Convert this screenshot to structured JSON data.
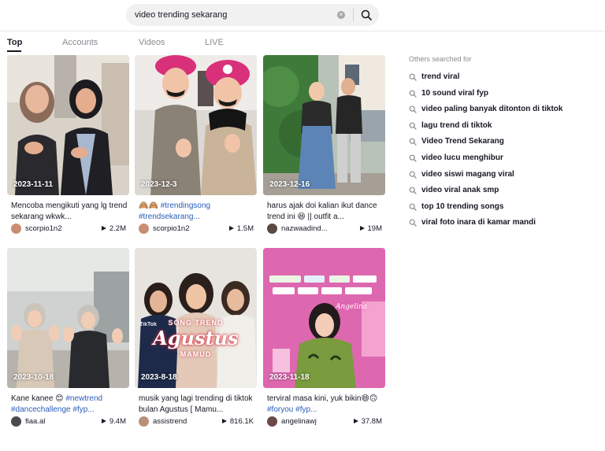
{
  "search": {
    "value": "video trending sekarang"
  },
  "tabs": [
    "Top",
    "Accounts",
    "Videos",
    "LIVE"
  ],
  "videos": [
    {
      "date": "2023-11-11",
      "caption_text": "Mencoba mengikuti yang lg trend sekarang wkwk...",
      "caption_tags": "",
      "username": "scorpio1n2",
      "views": "2.2M"
    },
    {
      "date": "2023-12-3",
      "caption_text": "🙈🙈 ",
      "caption_tags": "#trendingsong #trendsekarang...",
      "username": "scorpio1n2",
      "views": "1.5M"
    },
    {
      "date": "2023-12-16",
      "caption_text": "harus ajak doi kalian ikut dance trend ini 😆 || outfit a...",
      "caption_tags": "",
      "username": "nazwaadind...",
      "views": "19M"
    },
    {
      "date": "2023-10-18",
      "caption_text": "Kane kanee 😊 ",
      "caption_tags": "#newtrend #dancechallenge #fyp...",
      "username": "fiaa.al",
      "views": "9.4M"
    },
    {
      "date": "2023-8-18",
      "caption_text": "musik yang lagi trending di tiktok bulan Agustus [ Mamu...",
      "caption_tags": "",
      "username": "assistrend",
      "views": "816.1K"
    },
    {
      "date": "2023-11-18",
      "caption_text": "terviral masa kini, yuk bikin😄🙃 ",
      "caption_tags": "#foryou #fyp...",
      "username": "angelinawj",
      "views": "37.8M"
    }
  ],
  "overlay": {
    "line1": "SONG TREND",
    "line2": "Agustus",
    "line3": "MAMUD",
    "brand": "TikTok",
    "neon": "Angelina"
  },
  "others": {
    "title": "Others searched for",
    "items": [
      "trend viral",
      "10 sound viral fyp",
      "video paling banyak ditonton di tiktok",
      "lagu trend di tiktok",
      "Video Trend Sekarang",
      "video lucu menghibur",
      "video siswi magang viral",
      "video viral anak smp",
      "top 10 trending songs",
      "viral foto inara di kamar mandi"
    ]
  },
  "colors": {
    "text": "#161823",
    "secondary": "#8a8b91",
    "hashtag": "#2b5db9",
    "search_bg": "#f1f1f2"
  }
}
